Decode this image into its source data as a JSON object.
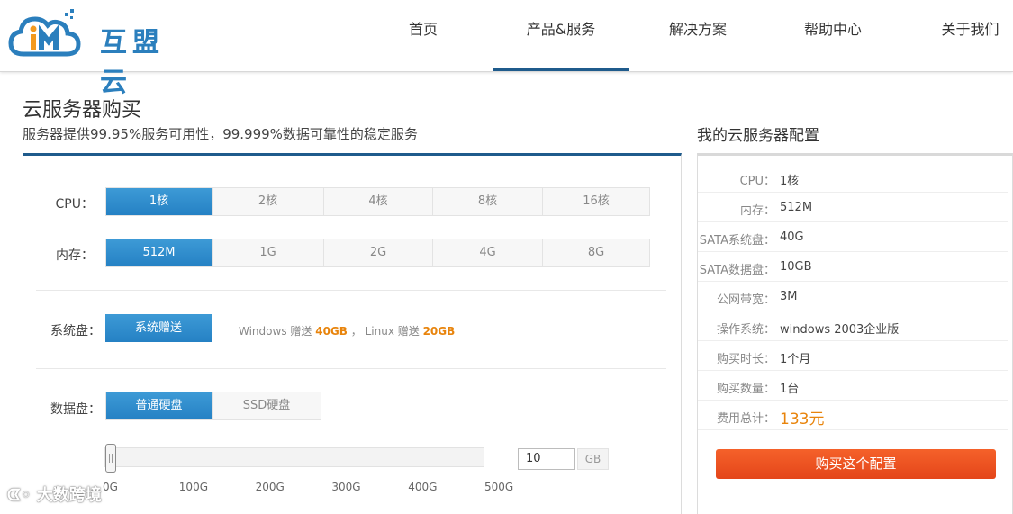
{
  "header": {
    "logo_text": "互盟云",
    "nav": [
      {
        "label": "首页",
        "active": false
      },
      {
        "label": "产品&服务",
        "active": true
      },
      {
        "label": "解决方案",
        "active": false
      },
      {
        "label": "帮助中心",
        "active": false
      },
      {
        "label": "关于我们",
        "active": false
      }
    ]
  },
  "page": {
    "title": "云服务器购买",
    "subtitle": "服务器提供99.95%服务可用性，99.999%数据可靠性的稳定服务"
  },
  "config": {
    "cpu": {
      "label": "CPU：",
      "options": [
        "1核",
        "2核",
        "4核",
        "8核",
        "16核"
      ],
      "selected": "1核"
    },
    "memory": {
      "label": "内存：",
      "options": [
        "512M",
        "1G",
        "2G",
        "4G",
        "8G"
      ],
      "selected": "512M"
    },
    "system_disk": {
      "label": "系统盘：",
      "button": "系统赠送",
      "note_windows": "Windows 赠送",
      "windows_size": "40GB",
      "note_sep": "，",
      "note_linux": "Linux 赠送",
      "linux_size": "20GB"
    },
    "data_disk": {
      "label": "数据盘：",
      "options": [
        "普通硬盘",
        "SSD硬盘"
      ],
      "selected": "普通硬盘",
      "slider_value": 10,
      "slider_min": 0,
      "slider_max": 500,
      "ticks": [
        "0G",
        "100G",
        "200G",
        "300G",
        "400G",
        "500G"
      ],
      "input_value": "10",
      "unit": "GB"
    }
  },
  "summary": {
    "title": "我的云服务器配置",
    "rows": [
      {
        "key": "CPU：",
        "value": "1核"
      },
      {
        "key": "内存：",
        "value": "512M"
      },
      {
        "key": "SATA系统盘：",
        "value": "40G"
      },
      {
        "key": "SATA数据盘：",
        "value": "10GB"
      },
      {
        "key": "公网带宽：",
        "value": "3M"
      },
      {
        "key": "操作系统：",
        "value": "windows 2003企业版"
      },
      {
        "key": "购买时长：",
        "value": "1个月"
      },
      {
        "key": "购买数量：",
        "value": "1台"
      },
      {
        "key": "费用总计：",
        "value": "133元"
      }
    ],
    "buy_button": "购买这个配置"
  },
  "watermark": "大数跨境",
  "colors": {
    "accent_blue": "#2581c4",
    "nav_underline": "#1f5b8c",
    "price_orange": "#e8840c",
    "buy_red": "#e4461a"
  }
}
